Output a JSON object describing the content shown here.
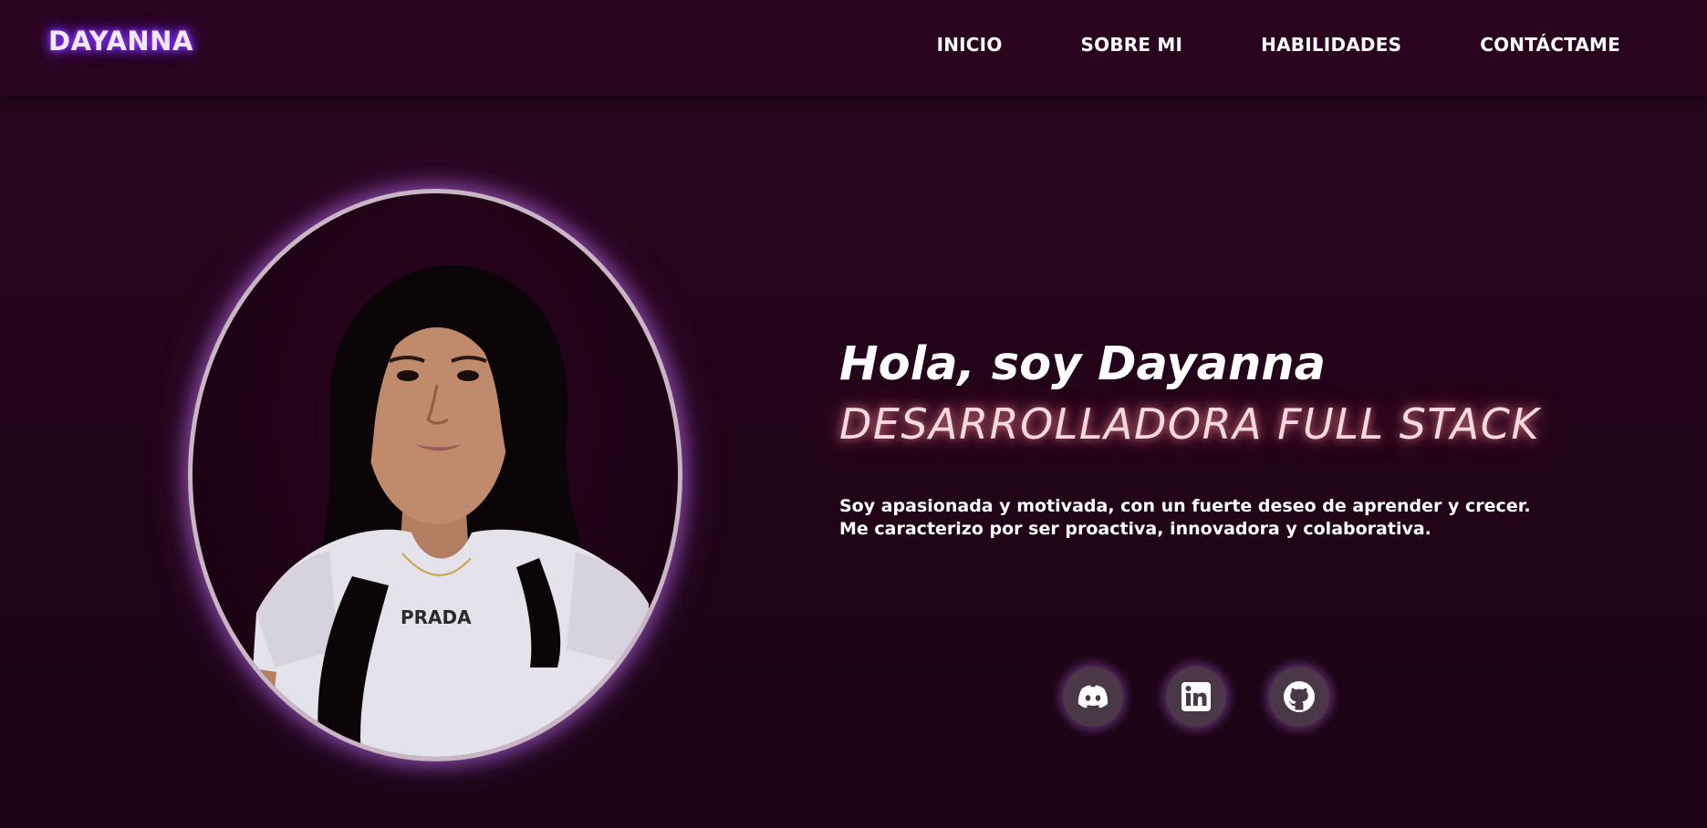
{
  "header": {
    "brand": "DAYANNA",
    "nav": [
      "INICIO",
      "SOBRE MI",
      "HABILIDADES",
      "CONTÁCTAME"
    ]
  },
  "hero": {
    "title": "Hola, soy Dayanna",
    "subtitle": "DESARROLLADORA FULL STACK",
    "description_line1": "Soy apasionada y motivada, con un fuerte deseo de aprender y crecer.",
    "description_line2": "Me caracterizo por ser proactiva, innovadora y colaborativa.",
    "portrait_shirt_text": "PRADA"
  },
  "social": {
    "icons": [
      "discord-icon",
      "linkedin-icon",
      "github-icon"
    ]
  },
  "colors": {
    "background": "#220419",
    "header": "#2a0520",
    "brand_glow": "#7a2dff",
    "subtitle": "#fbd9df",
    "social_button": "#4a3848",
    "portrait_border": "#c9b5c5"
  }
}
